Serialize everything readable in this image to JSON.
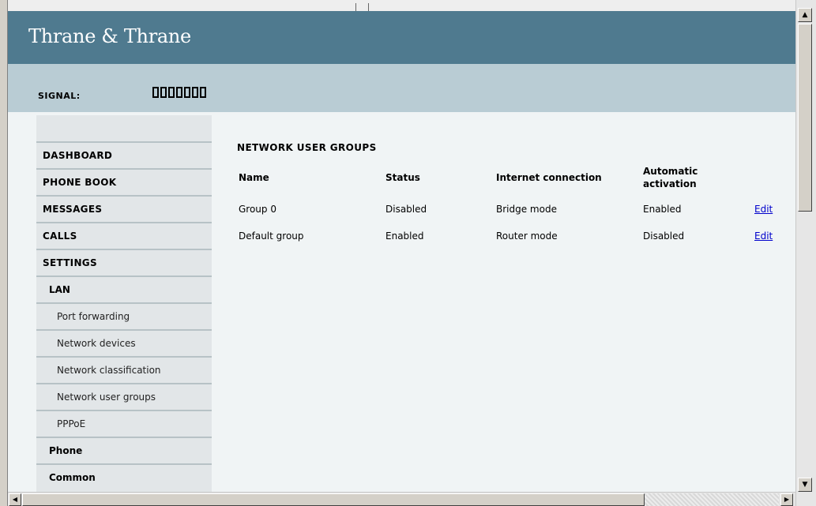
{
  "brand": {
    "logo_text": "Thrane & Thrane"
  },
  "signal": {
    "label": "SIGNAL:",
    "bars": 7
  },
  "sidebar": {
    "items": [
      {
        "label": "DASHBOARD"
      },
      {
        "label": "PHONE BOOK"
      },
      {
        "label": "MESSAGES"
      },
      {
        "label": "CALLS"
      },
      {
        "label": "SETTINGS"
      },
      {
        "label": "LAN"
      },
      {
        "label": "Port forwarding"
      },
      {
        "label": "Network devices"
      },
      {
        "label": "Network classification"
      },
      {
        "label": "Network user groups"
      },
      {
        "label": "PPPoE"
      },
      {
        "label": "Phone"
      },
      {
        "label": "Common"
      }
    ]
  },
  "main": {
    "title": "NETWORK USER GROUPS",
    "columns": [
      "Name",
      "Status",
      "Internet connection",
      "Automatic",
      "activation"
    ],
    "rows": [
      {
        "name": "Group 0",
        "status": "Disabled",
        "internet": "Bridge mode",
        "auto": "Enabled",
        "action": "Edit"
      },
      {
        "name": "Default group",
        "status": "Enabled",
        "internet": "Router mode",
        "auto": "Disabled",
        "action": "Edit"
      }
    ]
  },
  "colors": {
    "brand_bar": "#4f7a8f",
    "signal_bar": "#b9ccd4",
    "sidebar": "#e2e6e8",
    "link": "#0000cc"
  },
  "icons": {
    "scroll_up": "▲",
    "scroll_down": "▼",
    "scroll_left": "◀",
    "scroll_right": "▶"
  }
}
